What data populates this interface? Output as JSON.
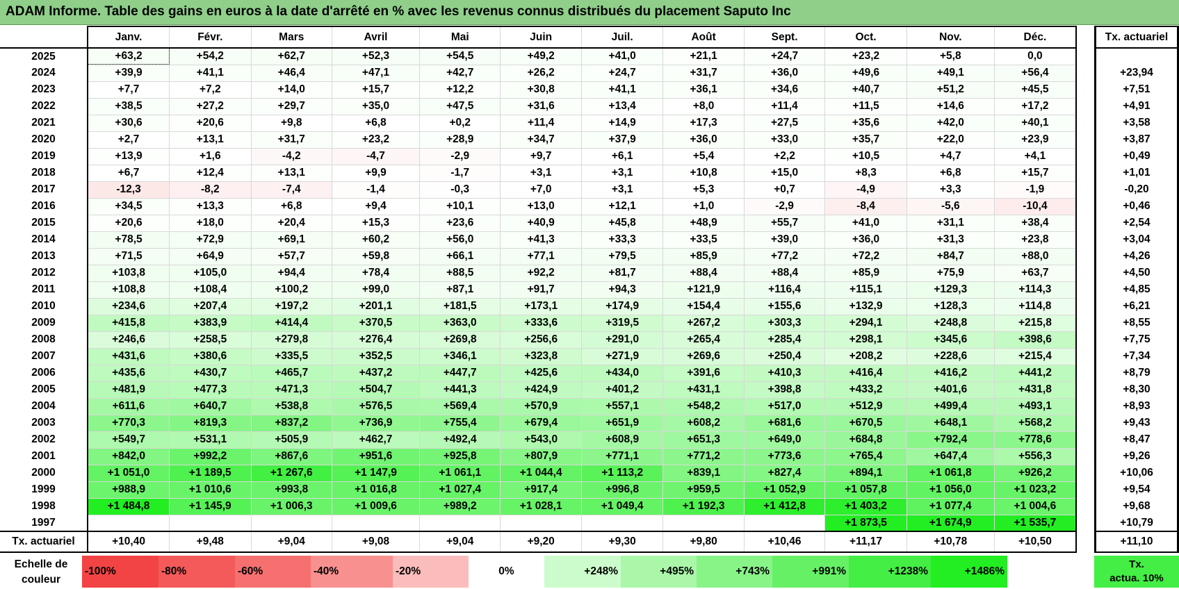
{
  "title": "ADAM Informe. Table des gains en euros à la date d'arrêté en % avec les revenus connus distribués du placement Saputo Inc",
  "months": [
    "Janv.",
    "Févr.",
    "Mars",
    "Avril",
    "Mai",
    "Juin",
    "Juil.",
    "Août",
    "Sept.",
    "Oct.",
    "Nov.",
    "Déc."
  ],
  "side_header": "Tx. actuariel",
  "rows": [
    {
      "year": "2025",
      "values": [
        "+63,2",
        "+54,2",
        "+62,7",
        "+52,3",
        "+54,5",
        "+49,2",
        "+41,0",
        "+21,1",
        "+24,7",
        "+23,2",
        "+5,8",
        "0,0"
      ],
      "rate": ""
    },
    {
      "year": "2024",
      "values": [
        "+39,9",
        "+41,1",
        "+46,4",
        "+47,1",
        "+42,7",
        "+26,2",
        "+24,7",
        "+31,7",
        "+36,0",
        "+49,6",
        "+49,1",
        "+56,4"
      ],
      "rate": "+23,94"
    },
    {
      "year": "2023",
      "values": [
        "+7,7",
        "+7,2",
        "+14,0",
        "+15,7",
        "+12,2",
        "+30,8",
        "+41,1",
        "+36,1",
        "+34,6",
        "+40,7",
        "+51,2",
        "+45,5"
      ],
      "rate": "+7,51"
    },
    {
      "year": "2022",
      "values": [
        "+38,5",
        "+27,2",
        "+29,7",
        "+35,0",
        "+47,5",
        "+31,6",
        "+13,4",
        "+8,0",
        "+11,4",
        "+11,5",
        "+14,6",
        "+17,2"
      ],
      "rate": "+4,91"
    },
    {
      "year": "2021",
      "values": [
        "+30,6",
        "+20,6",
        "+9,8",
        "+6,8",
        "+0,2",
        "+11,4",
        "+14,9",
        "+17,3",
        "+27,5",
        "+35,6",
        "+42,0",
        "+40,1"
      ],
      "rate": "+3,58"
    },
    {
      "year": "2020",
      "values": [
        "+2,7",
        "+13,1",
        "+31,7",
        "+23,2",
        "+28,9",
        "+34,7",
        "+37,9",
        "+36,0",
        "+33,0",
        "+35,7",
        "+22,0",
        "+23,9"
      ],
      "rate": "+3,87"
    },
    {
      "year": "2019",
      "values": [
        "+13,9",
        "+1,6",
        "-4,2",
        "-4,7",
        "-2,9",
        "+9,7",
        "+6,1",
        "+5,4",
        "+2,2",
        "+10,5",
        "+4,7",
        "+4,1"
      ],
      "rate": "+0,49"
    },
    {
      "year": "2018",
      "values": [
        "+6,7",
        "+12,4",
        "+13,1",
        "+9,9",
        "-1,7",
        "+3,1",
        "+3,1",
        "+10,8",
        "+15,0",
        "+8,3",
        "+6,8",
        "+15,7"
      ],
      "rate": "+1,01"
    },
    {
      "year": "2017",
      "values": [
        "-12,3",
        "-8,2",
        "-7,4",
        "-1,4",
        "-0,3",
        "+7,0",
        "+3,1",
        "+5,3",
        "+0,7",
        "-4,9",
        "+3,3",
        "-1,9"
      ],
      "rate": "-0,20"
    },
    {
      "year": "2016",
      "values": [
        "+34,5",
        "+13,3",
        "+6,8",
        "+9,4",
        "+10,1",
        "+13,0",
        "+12,1",
        "+1,0",
        "-2,9",
        "-8,4",
        "-5,6",
        "-10,4"
      ],
      "rate": "+0,46"
    },
    {
      "year": "2015",
      "values": [
        "+20,6",
        "+18,0",
        "+20,4",
        "+15,3",
        "+23,6",
        "+40,9",
        "+45,8",
        "+48,9",
        "+55,7",
        "+41,0",
        "+31,1",
        "+38,4"
      ],
      "rate": "+2,54"
    },
    {
      "year": "2014",
      "values": [
        "+78,5",
        "+72,9",
        "+69,1",
        "+60,2",
        "+56,0",
        "+41,3",
        "+33,3",
        "+33,5",
        "+39,0",
        "+36,0",
        "+31,3",
        "+23,8"
      ],
      "rate": "+3,04"
    },
    {
      "year": "2013",
      "values": [
        "+71,5",
        "+64,9",
        "+57,7",
        "+59,8",
        "+66,1",
        "+77,1",
        "+79,5",
        "+85,9",
        "+77,2",
        "+72,2",
        "+84,7",
        "+88,0"
      ],
      "rate": "+4,26"
    },
    {
      "year": "2012",
      "values": [
        "+103,8",
        "+105,0",
        "+94,4",
        "+78,4",
        "+88,5",
        "+92,2",
        "+81,7",
        "+88,4",
        "+88,4",
        "+85,9",
        "+75,9",
        "+63,7"
      ],
      "rate": "+4,50"
    },
    {
      "year": "2011",
      "values": [
        "+108,8",
        "+108,4",
        "+100,2",
        "+99,0",
        "+87,1",
        "+91,7",
        "+94,3",
        "+121,9",
        "+116,4",
        "+115,1",
        "+129,3",
        "+114,3"
      ],
      "rate": "+4,85"
    },
    {
      "year": "2010",
      "values": [
        "+234,6",
        "+207,4",
        "+197,2",
        "+201,1",
        "+181,5",
        "+173,1",
        "+174,9",
        "+154,4",
        "+155,6",
        "+132,9",
        "+128,3",
        "+114,8"
      ],
      "rate": "+6,21"
    },
    {
      "year": "2009",
      "values": [
        "+415,8",
        "+383,9",
        "+414,4",
        "+370,5",
        "+363,0",
        "+333,6",
        "+319,5",
        "+267,2",
        "+303,3",
        "+294,1",
        "+248,8",
        "+215,8"
      ],
      "rate": "+8,55"
    },
    {
      "year": "2008",
      "values": [
        "+246,6",
        "+258,5",
        "+279,8",
        "+276,4",
        "+269,8",
        "+256,6",
        "+291,0",
        "+265,4",
        "+285,4",
        "+298,1",
        "+345,6",
        "+398,6"
      ],
      "rate": "+7,75"
    },
    {
      "year": "2007",
      "values": [
        "+431,6",
        "+380,6",
        "+335,5",
        "+352,5",
        "+346,1",
        "+323,8",
        "+271,9",
        "+269,6",
        "+250,4",
        "+208,2",
        "+228,6",
        "+215,4"
      ],
      "rate": "+7,34"
    },
    {
      "year": "2006",
      "values": [
        "+435,6",
        "+430,7",
        "+465,7",
        "+437,2",
        "+447,7",
        "+425,6",
        "+434,0",
        "+391,6",
        "+410,3",
        "+416,4",
        "+416,2",
        "+441,2"
      ],
      "rate": "+8,79"
    },
    {
      "year": "2005",
      "values": [
        "+481,9",
        "+477,3",
        "+471,3",
        "+504,7",
        "+441,3",
        "+424,9",
        "+401,2",
        "+431,1",
        "+398,8",
        "+433,2",
        "+401,6",
        "+431,8"
      ],
      "rate": "+8,30"
    },
    {
      "year": "2004",
      "values": [
        "+611,6",
        "+640,7",
        "+538,8",
        "+576,5",
        "+569,4",
        "+570,9",
        "+557,1",
        "+548,2",
        "+517,0",
        "+512,9",
        "+499,4",
        "+493,1"
      ],
      "rate": "+8,93"
    },
    {
      "year": "2003",
      "values": [
        "+770,3",
        "+819,3",
        "+837,2",
        "+736,9",
        "+755,4",
        "+679,4",
        "+651,9",
        "+608,2",
        "+681,6",
        "+670,5",
        "+648,1",
        "+568,2"
      ],
      "rate": "+9,43"
    },
    {
      "year": "2002",
      "values": [
        "+549,7",
        "+531,1",
        "+505,9",
        "+462,7",
        "+492,4",
        "+543,0",
        "+608,9",
        "+651,3",
        "+649,0",
        "+684,8",
        "+792,4",
        "+778,6"
      ],
      "rate": "+8,47"
    },
    {
      "year": "2001",
      "values": [
        "+842,0",
        "+992,2",
        "+867,6",
        "+951,6",
        "+925,8",
        "+807,9",
        "+771,1",
        "+771,2",
        "+773,6",
        "+765,4",
        "+647,4",
        "+556,3"
      ],
      "rate": "+9,26"
    },
    {
      "year": "2000",
      "values": [
        "+1 051,0",
        "+1 189,5",
        "+1 267,6",
        "+1 147,9",
        "+1 061,1",
        "+1 044,4",
        "+1 113,2",
        "+839,1",
        "+827,4",
        "+894,1",
        "+1 061,8",
        "+926,2"
      ],
      "rate": "+10,06"
    },
    {
      "year": "1999",
      "values": [
        "+988,9",
        "+1 010,6",
        "+993,8",
        "+1 016,8",
        "+1 027,4",
        "+917,4",
        "+996,8",
        "+959,5",
        "+1 052,9",
        "+1 057,8",
        "+1 056,0",
        "+1 023,2"
      ],
      "rate": "+9,54"
    },
    {
      "year": "1998",
      "values": [
        "+1 484,8",
        "+1 145,9",
        "+1 006,3",
        "+1 009,6",
        "+989,2",
        "+1 028,1",
        "+1 049,4",
        "+1 192,3",
        "+1 412,8",
        "+1 403,2",
        "+1 077,4",
        "+1 004,6"
      ],
      "rate": "+9,68"
    },
    {
      "year": "1997",
      "values": [
        "",
        "",
        "",
        "",
        "",
        "",
        "",
        "",
        "",
        "+1 873,5",
        "+1 674,9",
        "+1 535,7"
      ],
      "rate": "+10,79"
    }
  ],
  "totals": {
    "label": "Tx. actuariel",
    "values": [
      "+10,40",
      "+9,48",
      "+9,04",
      "+9,08",
      "+9,04",
      "+9,20",
      "+9,30",
      "+9,80",
      "+10,46",
      "+11,17",
      "+10,78",
      "+10,50"
    ],
    "rate": "+11,10"
  },
  "scale": {
    "label_line1": "Echelle de",
    "label_line2": "couleur",
    "cells": [
      "-100%",
      "-80%",
      "-60%",
      "-40%",
      "-20%",
      "0%",
      "+248%",
      "+495%",
      "+743%",
      "+991%",
      "+1238%",
      "+1486%"
    ],
    "side_line1": "Tx.",
    "side_line2": "actua. 10%"
  },
  "colors": {
    "title_bg": "#8fcf8a",
    "neg_full": "#f24444",
    "pos_full": "#22ee22",
    "side_scale": "#44ee44"
  },
  "color_scale": {
    "neg_max": 100,
    "pos_max": 1486
  }
}
